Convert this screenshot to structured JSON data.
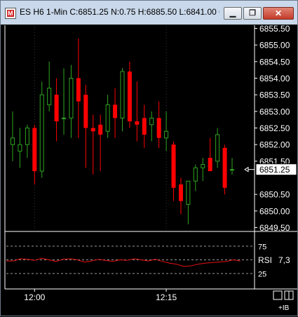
{
  "window": {
    "title": "ES H6 1-Min C:6851.25 N:0.75 H:6885.50 L:6841.00 O...",
    "app_icon_letter": "M",
    "min_glyph": "▁",
    "max_glyph": "❐",
    "close_glyph": "✕"
  },
  "chart_data": {
    "type": "candlestick",
    "price_axis": {
      "labels": [
        "6855.50",
        "6855.00",
        "6854.50",
        "6854.00",
        "6853.50",
        "6853.00",
        "6852.50",
        "6852.00",
        "6851.50",
        "6850.50",
        "6850.00",
        "6849.50"
      ],
      "values": [
        6855.5,
        6855.0,
        6854.5,
        6854.0,
        6853.5,
        6853.0,
        6852.5,
        6852.0,
        6851.5,
        6850.5,
        6850.0,
        6849.5
      ],
      "ylim": [
        6849.5,
        6855.6
      ]
    },
    "last_price": "6851.25",
    "last_price_value": 6851.25,
    "candles": [
      {
        "o": 6852.0,
        "h": 6853.0,
        "l": 6851.5,
        "c": 6852.2
      },
      {
        "o": 6851.8,
        "h": 6852.5,
        "l": 6851.3,
        "c": 6852.0
      },
      {
        "o": 6852.0,
        "h": 6852.6,
        "l": 6851.6,
        "c": 6852.5
      },
      {
        "o": 6852.5,
        "h": 6852.6,
        "l": 6850.8,
        "c": 6851.2
      },
      {
        "o": 6851.2,
        "h": 6853.9,
        "l": 6851.0,
        "c": 6853.5
      },
      {
        "o": 6853.2,
        "h": 6854.5,
        "l": 6853.0,
        "c": 6853.7
      },
      {
        "o": 6853.5,
        "h": 6854.0,
        "l": 6852.1,
        "c": 6852.7
      },
      {
        "o": 6852.8,
        "h": 6854.3,
        "l": 6852.3,
        "c": 6852.8
      },
      {
        "o": 6852.8,
        "h": 6854.4,
        "l": 6852.2,
        "c": 6854.0
      },
      {
        "o": 6854.0,
        "h": 6855.2,
        "l": 6852.2,
        "c": 6853.3
      },
      {
        "o": 6853.5,
        "h": 6853.8,
        "l": 6851.3,
        "c": 6852.5
      },
      {
        "o": 6852.5,
        "h": 6852.9,
        "l": 6851.1,
        "c": 6852.4
      },
      {
        "o": 6852.6,
        "h": 6852.9,
        "l": 6851.2,
        "c": 6852.3
      },
      {
        "o": 6852.4,
        "h": 6853.5,
        "l": 6852.2,
        "c": 6853.2
      },
      {
        "o": 6853.2,
        "h": 6853.7,
        "l": 6852.2,
        "c": 6852.8
      },
      {
        "o": 6852.8,
        "h": 6854.3,
        "l": 6852.4,
        "c": 6854.2
      },
      {
        "o": 6854.2,
        "h": 6854.5,
        "l": 6852.5,
        "c": 6852.7
      },
      {
        "o": 6852.7,
        "h": 6853.9,
        "l": 6852.1,
        "c": 6852.6
      },
      {
        "o": 6852.8,
        "h": 6853.2,
        "l": 6851.9,
        "c": 6852.3
      },
      {
        "o": 6852.6,
        "h": 6853.0,
        "l": 6852.1,
        "c": 6852.8
      },
      {
        "o": 6852.8,
        "h": 6853.3,
        "l": 6851.9,
        "c": 6852.2
      },
      {
        "o": 6852.2,
        "h": 6853.0,
        "l": 6851.8,
        "c": 6852.4
      },
      {
        "o": 6852.0,
        "h": 6852.1,
        "l": 6850.3,
        "c": 6850.7
      },
      {
        "o": 6850.8,
        "h": 6851.0,
        "l": 6849.9,
        "c": 6850.3
      },
      {
        "o": 6850.2,
        "h": 6850.9,
        "l": 6849.6,
        "c": 6850.9
      },
      {
        "o": 6850.9,
        "h": 6851.4,
        "l": 6850.6,
        "c": 6851.3
      },
      {
        "o": 6851.3,
        "h": 6851.6,
        "l": 6850.9,
        "c": 6851.4
      },
      {
        "o": 6851.6,
        "h": 6852.2,
        "l": 6851.2,
        "c": 6851.2
      },
      {
        "o": 6851.5,
        "h": 6852.5,
        "l": 6851.3,
        "c": 6852.3
      },
      {
        "o": 6851.9,
        "h": 6852.0,
        "l": 6850.5,
        "c": 6850.7
      },
      {
        "o": 6851.25,
        "h": 6851.6,
        "l": 6851.1,
        "c": 6851.25
      }
    ],
    "rsi": {
      "label": "RSI",
      "value": "7,3",
      "levels": [
        75,
        50,
        25
      ],
      "level_labels": [
        "75",
        "25"
      ],
      "series": [
        48,
        48,
        52,
        51,
        49,
        53,
        50,
        47,
        51,
        52,
        50,
        46,
        48,
        51,
        49,
        47,
        50,
        49,
        52,
        50,
        48,
        51,
        47,
        44,
        42,
        38,
        39,
        42,
        44,
        45,
        46,
        47,
        50,
        48
      ]
    },
    "time_axis": {
      "labels": [
        "12:00",
        "12:15"
      ],
      "label_candle_index": [
        3,
        21
      ]
    }
  },
  "footer": {
    "right_label": "+IB",
    "icon_left": "single-pane-icon",
    "icon_right": "split-pane-icon"
  }
}
